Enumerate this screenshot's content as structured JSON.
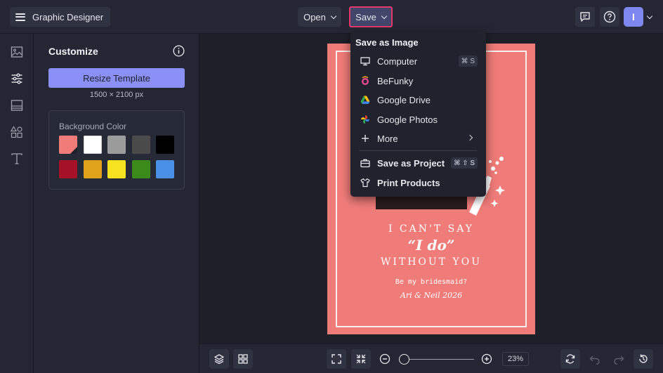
{
  "topbar": {
    "app_title": "Graphic Designer",
    "open_label": "Open",
    "save_label": "Save",
    "avatar_initial": "I"
  },
  "panel": {
    "title": "Customize",
    "resize_label": "Resize Template",
    "dimensions": "1500 × 2100 px",
    "bg_label": "Background Color",
    "swatches": [
      "#f07c79",
      "#ffffff",
      "#9b9b9b",
      "#4a4a4a",
      "#000000",
      "#a51126",
      "#e0a11b",
      "#f7e21f",
      "#3c8b1a",
      "#4a90e6"
    ],
    "selected_swatch": "#f07c79"
  },
  "design": {
    "line1": "I CAN'T SAY",
    "line2": "“I do”",
    "line3": "WITHOUT YOU",
    "line4": "Be my bridesmaid?",
    "line5": "Ari & Neil 2026"
  },
  "bottombar": {
    "zoom_value": "23%"
  },
  "save_menu": {
    "heading": "Save as Image",
    "items": [
      {
        "label": "Computer",
        "shortcut": "⌘ S",
        "icon": "monitor-icon"
      },
      {
        "label": "BeFunky",
        "icon": "befunky-icon"
      },
      {
        "label": "Google Drive",
        "icon": "google-drive-icon"
      },
      {
        "label": "Google Photos",
        "icon": "google-photos-icon"
      },
      {
        "label": "More",
        "icon": "plus-icon"
      }
    ],
    "project_items": [
      {
        "label": "Save as Project",
        "shortcut": "⌘ ⇧ S",
        "icon": "briefcase-icon"
      },
      {
        "label": "Print Products",
        "icon": "tshirt-icon"
      }
    ]
  },
  "colors": {
    "accent": "#8a90f5",
    "save_highlight": "#e23a6b",
    "design_bg": "#f07c79"
  }
}
